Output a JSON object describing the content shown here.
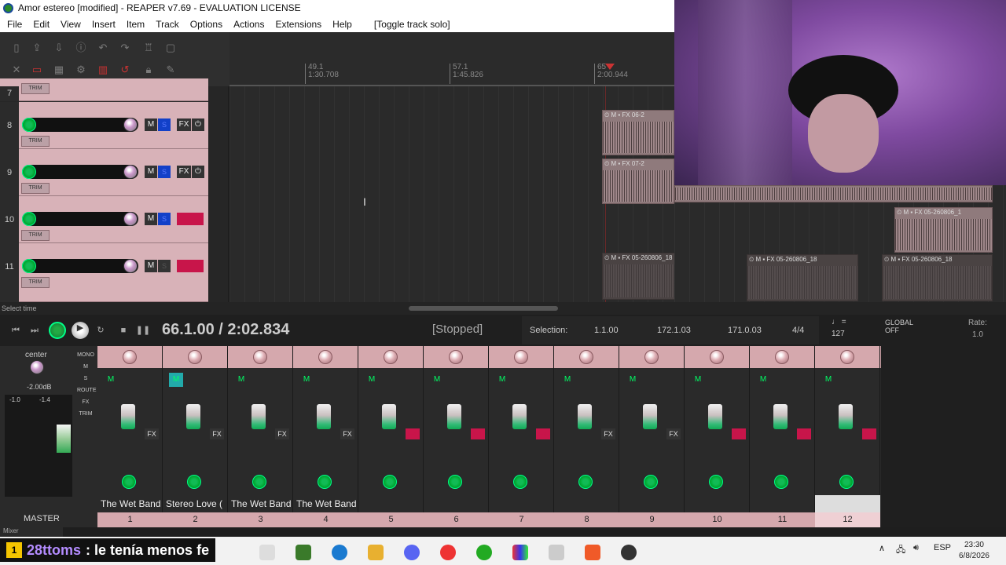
{
  "window": {
    "title": "Amor estereo [modified] - REAPER v7.69 - EVALUATION LICENSE"
  },
  "menu": {
    "items": [
      "File",
      "Edit",
      "View",
      "Insert",
      "Item",
      "Track",
      "Options",
      "Actions",
      "Extensions",
      "Help"
    ],
    "toggle_solo": "[Toggle track solo]"
  },
  "ruler": {
    "marks": [
      {
        "bar": "49.1",
        "time": "1:30.708"
      },
      {
        "bar": "57.1",
        "time": "1:45.826"
      },
      {
        "bar": "65",
        "time": "2:00.944"
      }
    ]
  },
  "tracks": [
    {
      "num": "7"
    },
    {
      "num": "8",
      "solo_color": "blue",
      "fx": true
    },
    {
      "num": "9",
      "solo_color": "blue",
      "fx": true
    },
    {
      "num": "10",
      "solo_color": "blue",
      "fx_red": true
    },
    {
      "num": "11",
      "solo_color": "dark",
      "fx_red": true
    }
  ],
  "buttons": {
    "mute": "M",
    "solo": "S",
    "fx": "FX",
    "trim": "TRIM"
  },
  "items": [
    {
      "label": "06-2"
    },
    {
      "label": "07-2"
    },
    {
      "label": "05-260806_1"
    },
    {
      "label": "05-260806_18"
    },
    {
      "label": "05-260806_18"
    },
    {
      "label": "05-260806_18"
    }
  ],
  "status": {
    "hint": "Select time"
  },
  "transport": {
    "position": "66.1.00 / 2:02.834",
    "state": "[Stopped]",
    "selection_label": "Selection:",
    "sel_start": "1.1.00",
    "sel_end": "172.1.03",
    "sel_len": "171.0.03",
    "time_sig": "4/4",
    "bpm": "127",
    "global_label": "GLOBAL",
    "global_value": "OFF",
    "rate_label": "Rate:",
    "rate_value": "1.0"
  },
  "master": {
    "pan_label": "center",
    "volume": "-2.00dB",
    "peak_l": "-1.0",
    "peak_r": "-1.4",
    "label": "MASTER",
    "side_buttons": [
      "MONO",
      "M",
      "S",
      "ROUTE",
      "FX",
      "TRIM"
    ]
  },
  "strips": [
    {
      "num": "1",
      "name": "The Wet Band",
      "mute_on": false,
      "fx": "FX",
      "fx_red": false
    },
    {
      "num": "2",
      "name": "Stereo Love (",
      "mute_on": true,
      "fx": "FX",
      "fx_red": false
    },
    {
      "num": "3",
      "name": "The Wet Band",
      "mute_on": false,
      "fx": "FX",
      "fx_red": false
    },
    {
      "num": "4",
      "name": "The Wet Band",
      "mute_on": false,
      "fx": "FX",
      "fx_red": false
    },
    {
      "num": "5",
      "name": "",
      "mute_on": false,
      "fx": "FX",
      "fx_red": true
    },
    {
      "num": "6",
      "name": "",
      "mute_on": false,
      "fx": "FX",
      "fx_red": true
    },
    {
      "num": "7",
      "name": "",
      "mute_on": false,
      "fx": "FX",
      "fx_red": true
    },
    {
      "num": "8",
      "name": "",
      "mute_on": false,
      "fx": "FX",
      "fx_red": false
    },
    {
      "num": "9",
      "name": "",
      "mute_on": false,
      "fx": "FX",
      "fx_red": false
    },
    {
      "num": "10",
      "name": "",
      "mute_on": false,
      "fx": "FX",
      "fx_red": true
    },
    {
      "num": "11",
      "name": "",
      "mute_on": false,
      "fx": "FX",
      "fx_red": true
    },
    {
      "num": "12",
      "name": "",
      "mute_on": false,
      "fx": "FX",
      "fx_red": true,
      "selected": true
    }
  ],
  "mixer_tab": "Mixer",
  "chat": {
    "badge": "1",
    "user": "28ttoms",
    "message": ": le tenía menos fe"
  },
  "tray": {
    "lang": "ESP",
    "time": "23:30",
    "date": "6/8/2026"
  },
  "colors": {
    "track_color": "#d8b2b8",
    "solo_blue": "#1240c8",
    "fx_red": "#c8154a",
    "knob_green": "#00aa44"
  }
}
